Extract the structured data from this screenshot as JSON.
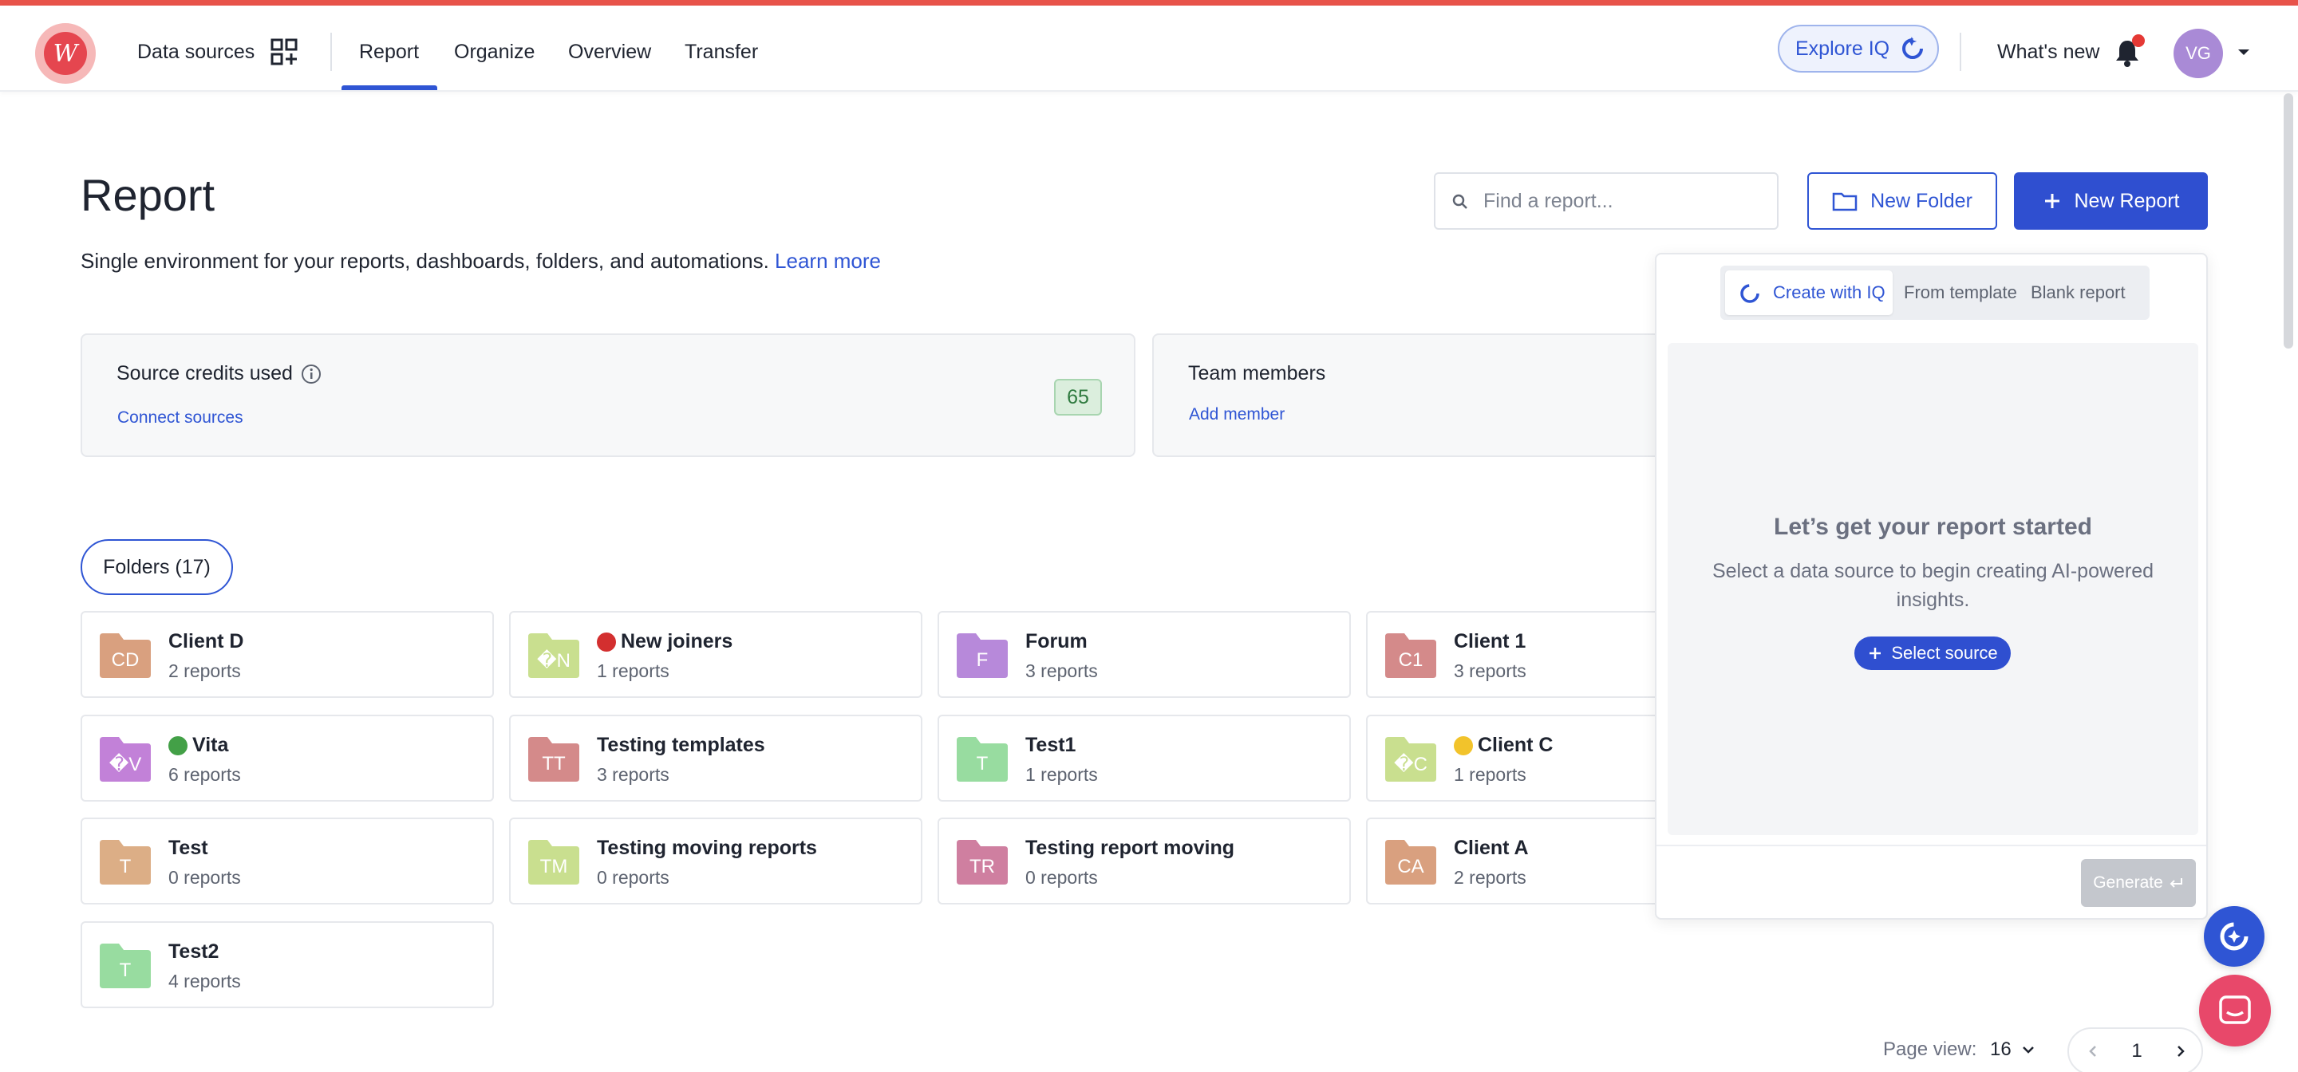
{
  "nav": {
    "logo_letter": "W",
    "data_sources": "Data sources",
    "items": [
      "Report",
      "Organize",
      "Overview",
      "Transfer"
    ],
    "explore": "Explore IQ",
    "whats_new": "What's new",
    "avatar_initials": "VG"
  },
  "page": {
    "title": "Report",
    "subtitle": "Single environment for your reports, dashboards, folders, and automations.",
    "learn_more": "Learn more"
  },
  "search": {
    "placeholder": "Find a report...",
    "value": ""
  },
  "actions": {
    "new_folder": "New Folder",
    "new_report": "New Report"
  },
  "credits_card": {
    "title": "Source credits used",
    "link": "Connect sources",
    "value": "65"
  },
  "team_card": {
    "title": "Team members",
    "link": "Add member"
  },
  "folders_pill": "Folders (17)",
  "folders": [
    {
      "initials": "CD",
      "name": "Client D",
      "count": "2 reports",
      "color": "#d9a07f",
      "dot": ""
    },
    {
      "initials": "�N",
      "name": "New joiners",
      "count": "1 reports",
      "color": "#c9df8f",
      "dot": "#d32f2f"
    },
    {
      "initials": "F",
      "name": "Forum",
      "count": "3 reports",
      "color": "#b789da",
      "dot": ""
    },
    {
      "initials": "C1",
      "name": "Client 1",
      "count": "3 reports",
      "color": "#d48a8a",
      "dot": ""
    },
    {
      "initials": "�V",
      "name": "Vita",
      "count": "6 reports",
      "color": "#c281d8",
      "dot": "#43a047"
    },
    {
      "initials": "TT",
      "name": "Testing templates",
      "count": "3 reports",
      "color": "#d48a8a",
      "dot": ""
    },
    {
      "initials": "T",
      "name": "Test1",
      "count": "1 reports",
      "color": "#98dca0",
      "dot": ""
    },
    {
      "initials": "�C",
      "name": "Client C",
      "count": "1 reports",
      "color": "#c9df8f",
      "dot": "#f2c32b"
    },
    {
      "initials": "T",
      "name": "Test",
      "count": "0 reports",
      "color": "#dcae86",
      "dot": ""
    },
    {
      "initials": "TM",
      "name": "Testing moving reports",
      "count": "0 reports",
      "color": "#c9df8f",
      "dot": ""
    },
    {
      "initials": "TR",
      "name": "Testing report moving",
      "count": "0 reports",
      "color": "#cf7fa0",
      "dot": ""
    },
    {
      "initials": "CA",
      "name": "Client A",
      "count": "2 reports",
      "color": "#d9a07f",
      "dot": ""
    },
    {
      "initials": "T",
      "name": "Test2",
      "count": "4 reports",
      "color": "#98dca0",
      "dot": ""
    }
  ],
  "iq_panel": {
    "tabs": [
      "Create with IQ",
      "From template",
      "Blank report"
    ],
    "heading": "Let’s get your report started",
    "text": "Select a data source to begin creating AI-powered insights.",
    "select_source": "Select source",
    "generate": "Generate"
  },
  "pagination": {
    "label": "Page view:",
    "per_page": "16",
    "current": "1"
  },
  "colors": {
    "accent": "#2f55d4",
    "brand": "#e5464f",
    "chat": "#e8486a"
  }
}
